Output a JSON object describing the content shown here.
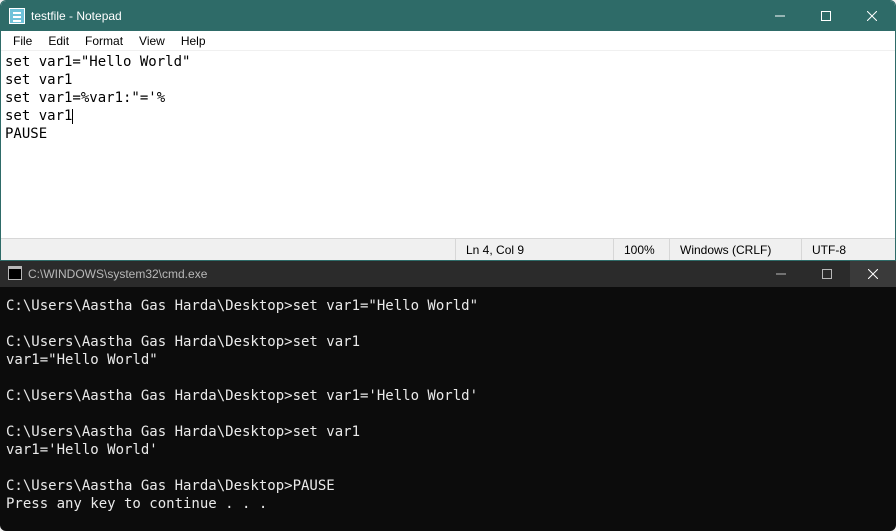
{
  "notepad": {
    "title": "testfile - Notepad",
    "menu": {
      "file": "File",
      "edit": "Edit",
      "format": "Format",
      "view": "View",
      "help": "Help"
    },
    "lines": {
      "l1": "set var1=\"Hello World\"",
      "l2": "set var1",
      "l3": "set var1=%var1:\"='%",
      "l4": "set var1",
      "l5": "PAUSE"
    },
    "status": {
      "lncol": "Ln 4, Col 9",
      "zoom": "100%",
      "eol": "Windows (CRLF)",
      "encoding": "UTF-8"
    }
  },
  "cmd": {
    "title": "C:\\WINDOWS\\system32\\cmd.exe",
    "body": "C:\\Users\\Aastha Gas Harda\\Desktop>set var1=\"Hello World\"\n\nC:\\Users\\Aastha Gas Harda\\Desktop>set var1\nvar1=\"Hello World\"\n\nC:\\Users\\Aastha Gas Harda\\Desktop>set var1='Hello World'\n\nC:\\Users\\Aastha Gas Harda\\Desktop>set var1\nvar1='Hello World'\n\nC:\\Users\\Aastha Gas Harda\\Desktop>PAUSE\nPress any key to continue . . ."
  }
}
